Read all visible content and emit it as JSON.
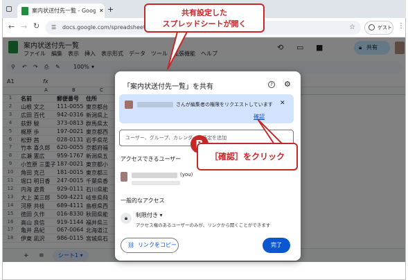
{
  "browser": {
    "tab_title": "案内状送付先一覧 - Google スプ",
    "new_tab": "+",
    "url": "docs.google.com/spreadsheets/d/",
    "profile_label": "ゲスト"
  },
  "sheet": {
    "doc_title": "案内状送付先一覧",
    "menu": [
      "ファイル",
      "編集",
      "表示",
      "挿入",
      "表示形式",
      "データ",
      "ツール",
      "拡張機能",
      "ヘルプ"
    ],
    "zoom": "100%",
    "cell_ref": "A1",
    "share_label": "共有",
    "columns": [
      "A",
      "B",
      "C"
    ],
    "headers": [
      "名前",
      "郵便番号",
      "住所"
    ],
    "rows": [
      [
        "山根 文之",
        "111-0055",
        "東京都台"
      ],
      [
        "広田 百代",
        "942-0316",
        "新潟県上"
      ],
      [
        "荻野 駿",
        "373-0813",
        "群馬県太"
      ],
      [
        "梶原 歩",
        "197-0021",
        "東京都西"
      ],
      [
        "松野 茜",
        "028-0131",
        "岩手県花"
      ],
      [
        "竹本 喜久郎",
        "620-0055",
        "京都府福"
      ],
      [
        "広瀬 憲広",
        "959-1767",
        "新潟県五"
      ],
      [
        "小笠原 三重子",
        "187-0021",
        "東京都小"
      ],
      [
        "角田 克己",
        "181-0015",
        "東京都三"
      ],
      [
        "堀口 明日香",
        "247-0015",
        "千葉県香"
      ],
      [
        "内海 遊貴",
        "929-0111",
        "石川県能"
      ],
      [
        "大上 美三郎",
        "509-4221",
        "岐阜県飛"
      ],
      [
        "河原 共枝",
        "689-4111",
        "島根県西"
      ],
      [
        "徳田 久作",
        "016-8330",
        "秋田県能"
      ],
      [
        "高山 良信",
        "919-1144",
        "福井県三"
      ],
      [
        "亀井 昌紀",
        "067-0064",
        "北海道江"
      ],
      [
        "伊東 凪沢",
        "986-0115",
        "宮城県石"
      ]
    ],
    "sheet_tab": "シート1"
  },
  "dialog": {
    "title": "「案内状送付先一覧」を共有",
    "request_text": "さんが編集者の権限をリクエストしています",
    "confirm_label": "確認",
    "add_placeholder": "ユーザー、グループ、カレンダーの予定を追加",
    "access_heading": "アクセスできるユーザー",
    "user_suffix": "(you)",
    "general_heading": "一般的なアクセス",
    "restricted_label": "制限付き",
    "restricted_desc": "アクセス権のあるユーザーのみが、リンクから開くことができます",
    "copy_link": "リンクをコピー",
    "done": "完了"
  },
  "annotations": {
    "top_callout": [
      "共有設定した",
      "スプレッドシートが開く"
    ],
    "b_marker": "B",
    "click_callout": "［確認］をクリック"
  },
  "colors": {
    "accent": "#0b57d0",
    "callout_red": "#c62828",
    "sheets_green": "#1e8e3e"
  }
}
